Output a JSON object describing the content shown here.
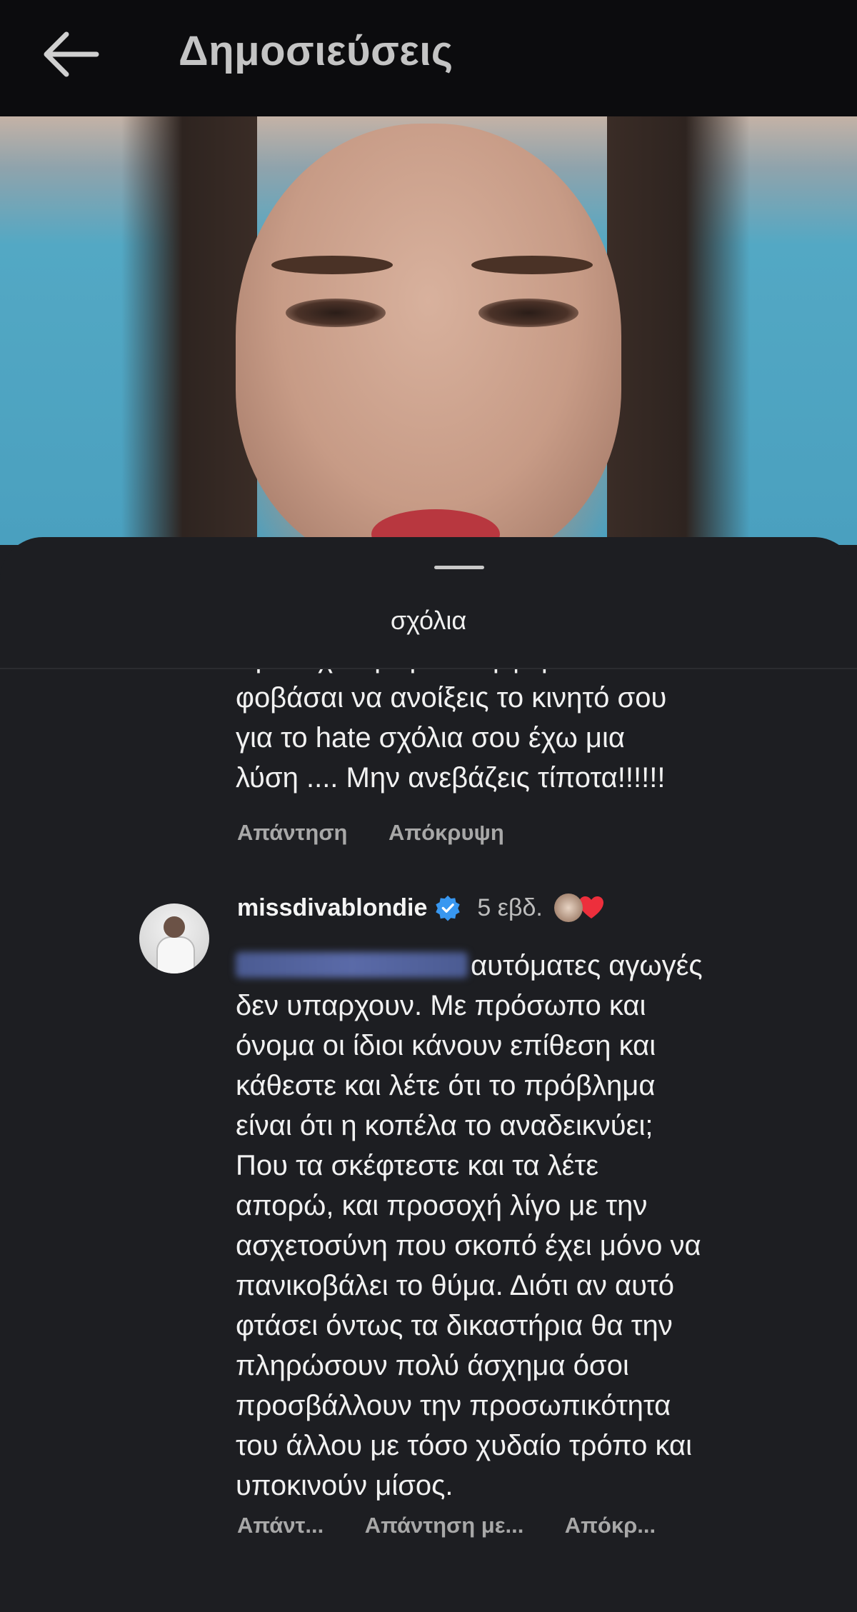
{
  "header": {
    "title": "Δημοσιεύσεις"
  },
  "sheet": {
    "title": "σχόλια"
  },
  "comment1": {
    "text_lines": [
      "προσεχτική την άλλη φορά ... Αν",
      "φοβάσαι να ανοίξεις το κινητό σου",
      "για το hate σχόλια σου έχω μια",
      "λύση .... Μην ανεβάζεις τίποτα!!!!!!"
    ],
    "actions": {
      "reply": "Απάντηση",
      "hide": "Απόκρυψη"
    }
  },
  "comment2": {
    "username": "missdivablondie",
    "time": "5 εβδ.",
    "text_lines": [
      "αυτόματες αγωγές",
      "δεν υπαρχουν. Με πρόσωπο και",
      "όνομα οι ίδιοι κάνουν επίθεση και",
      "κάθεστε και λέτε ότι το πρόβλημα",
      "είναι ότι η κοπέλα το αναδεικνύει;",
      "Που τα σκέφτεστε και τα λέτε",
      "απορώ, και προσοχή λίγο με την",
      "ασχετοσύνη που σκοπό έχει μόνο να",
      "πανικοβάλει το θύμα. Διότι αν αυτό",
      "φτάσει όντως τα δικαστήρια θα την",
      "πληρώσουν πολύ άσχημα όσοι",
      "προσβάλλουν την προσωπικότητα",
      "του άλλου με τόσο χυδαίο τρόπο και",
      "υποκινούν μίσος."
    ],
    "actions": {
      "reply": "Απάντ...",
      "reply_with": "Απάντηση με...",
      "hide": "Απόκρ..."
    }
  },
  "colors": {
    "accent_verified": "#3897f0",
    "heart": "#ed2f3c",
    "background": "#1d1e22"
  }
}
